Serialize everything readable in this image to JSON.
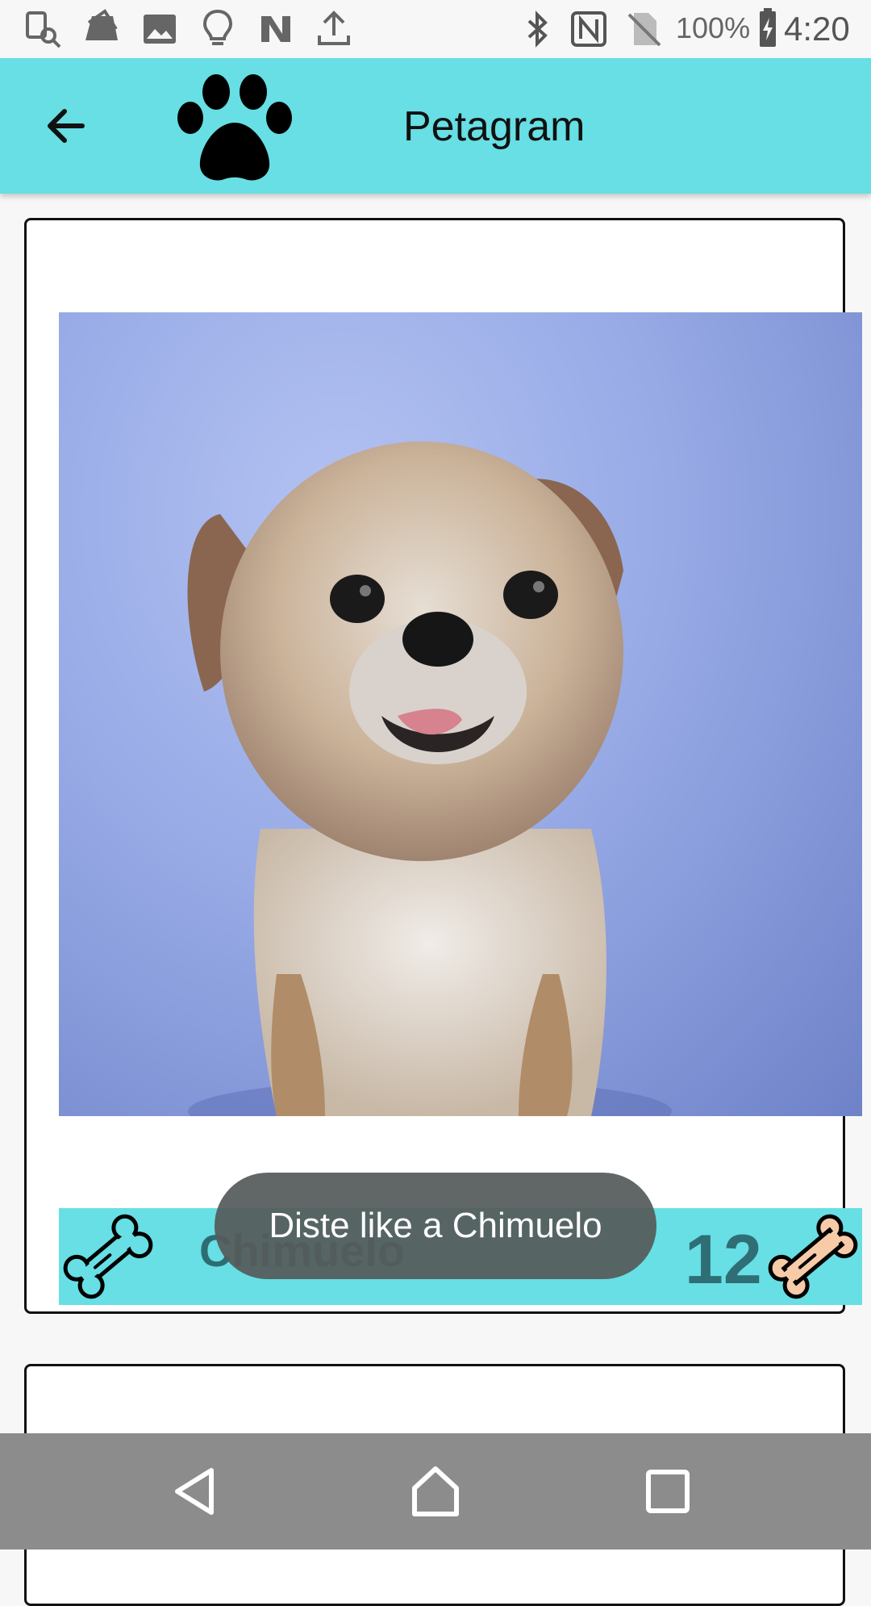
{
  "status_bar": {
    "battery": "100%",
    "time": "4:20",
    "left_icons": [
      "screenshot-icon",
      "overlay-icon",
      "gallery-icon",
      "lightbulb-icon",
      "n-app-icon",
      "upload-icon"
    ],
    "right_icons": [
      "bluetooth-icon",
      "nfc-icon",
      "no-sim-icon",
      "battery-charging-icon"
    ]
  },
  "toolbar": {
    "title": "Petagram",
    "back_icon": "arrow-back-icon",
    "logo_icon": "paw-icon",
    "background": "#67dfe4"
  },
  "card": {
    "pet_name": "Chimuelo",
    "like_count": "12",
    "like_button_icon": "bone-outline-icon",
    "rating_icon": "bone-filled-icon"
  },
  "toast": {
    "message": "Diste like a Chimuelo"
  },
  "nav_bar": {
    "buttons": [
      "back-icon",
      "home-icon",
      "recents-icon"
    ]
  }
}
